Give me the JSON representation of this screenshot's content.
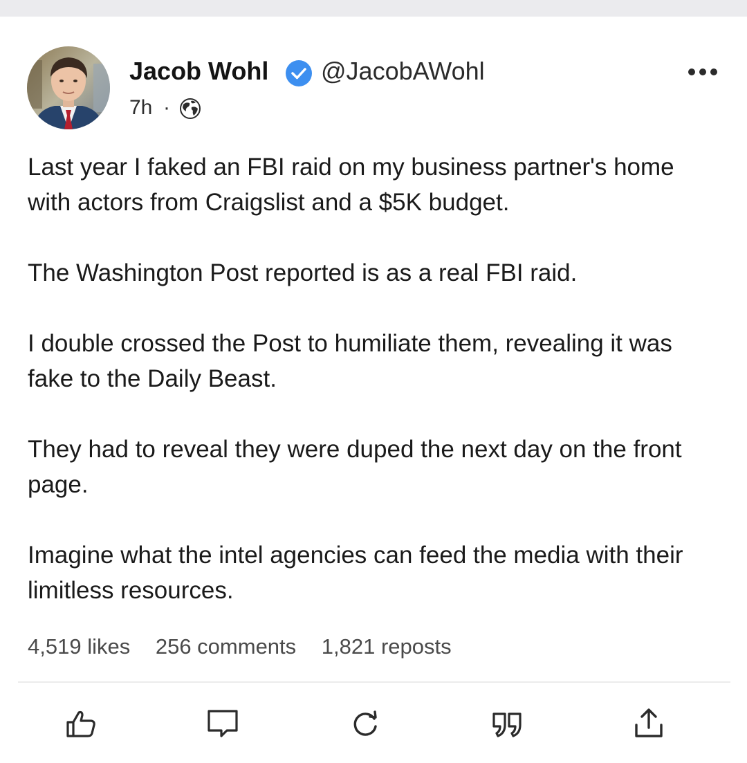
{
  "post": {
    "author_name": "Jacob Wohl",
    "handle": "@JacobAWohl",
    "time": "7h",
    "separator": "·",
    "paragraphs": [
      "Last year I faked an FBI raid on my business partner's home with actors from Craigslist and a $5K budget.",
      "The Washington Post reported is as a real FBI raid.",
      "I double crossed the Post to humiliate them, revealing it was fake to the Daily Beast.",
      "They had to reveal they were duped the next day on the front page.",
      "Imagine what the intel agencies can feed the media with their limitless resources."
    ],
    "stats": {
      "likes": "4,519 likes",
      "comments": "256 comments",
      "reposts": "1,821 reposts"
    }
  },
  "icons": {
    "verified": "verified-badge-icon",
    "more": "more-options-icon",
    "visibility": "globe-icon",
    "actions": [
      "thumbs-up-icon",
      "comment-icon",
      "repost-icon",
      "quote-icon",
      "share-icon"
    ]
  },
  "colors": {
    "verified_blue": "#3d8ff0",
    "background": "#ffffff",
    "page_bg": "#ebebee",
    "text": "#1a1a1a",
    "icon": "#2b2b2b"
  }
}
